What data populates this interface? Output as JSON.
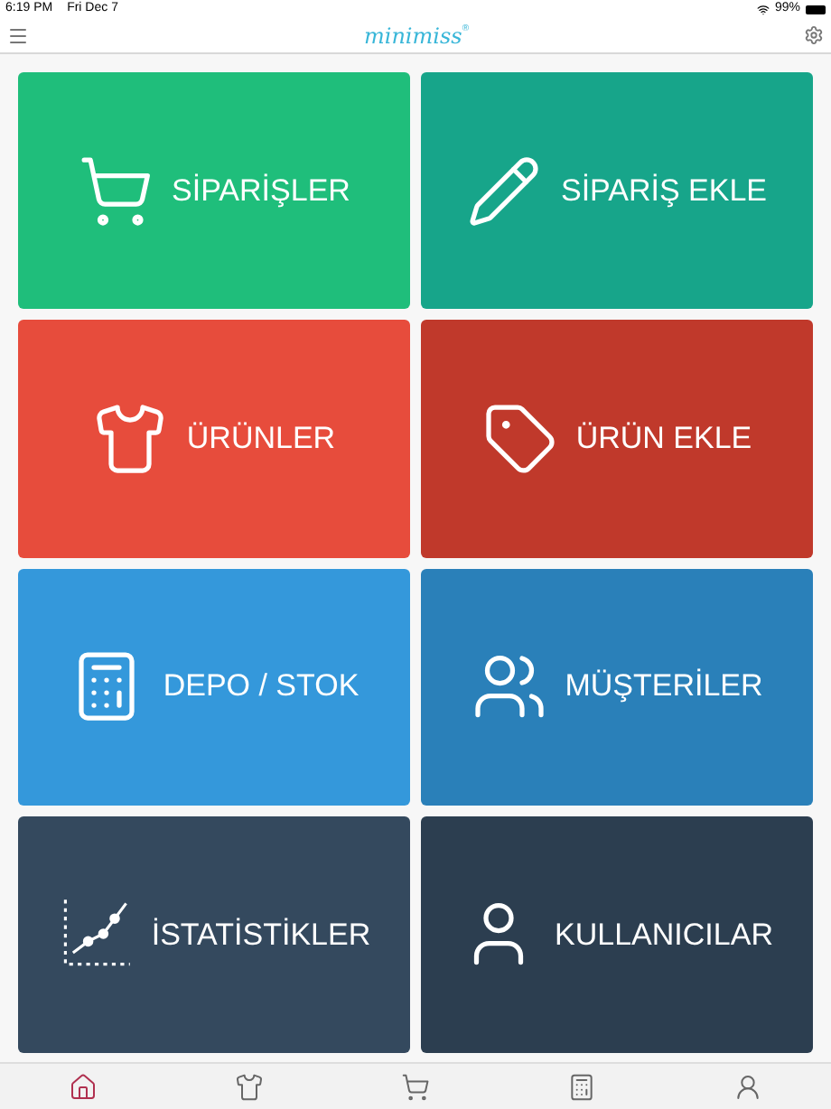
{
  "status_bar": {
    "time": "6:19 PM",
    "date": "Fri Dec 7",
    "battery": "99%"
  },
  "header": {
    "logo": "minimiss",
    "logo_mark": "®"
  },
  "tiles": [
    {
      "kind": "cart",
      "label": "SİPARİŞLER",
      "color": "#1fbe7b"
    },
    {
      "kind": "pencil",
      "label": "SİPARİŞ EKLE",
      "color": "#17a58a"
    },
    {
      "kind": "shirt",
      "label": "ÜRÜNLER",
      "color": "#e74c3c"
    },
    {
      "kind": "tag",
      "label": "ÜRÜN EKLE",
      "color": "#c0392b"
    },
    {
      "kind": "calculator",
      "label": "DEPO / STOK",
      "color": "#3498db"
    },
    {
      "kind": "users",
      "label": "MÜŞTERİLER",
      "color": "#2a80b9"
    },
    {
      "kind": "chart",
      "label": "İSTATİSTİKLER",
      "color": "#34495e"
    },
    {
      "kind": "user",
      "label": "KULLANICILAR",
      "color": "#2c3e50"
    }
  ],
  "tab_bar": [
    {
      "kind": "home",
      "selected": true
    },
    {
      "kind": "shirt",
      "selected": false
    },
    {
      "kind": "cart",
      "selected": false
    },
    {
      "kind": "calculator",
      "selected": false
    },
    {
      "kind": "user",
      "selected": false
    }
  ]
}
